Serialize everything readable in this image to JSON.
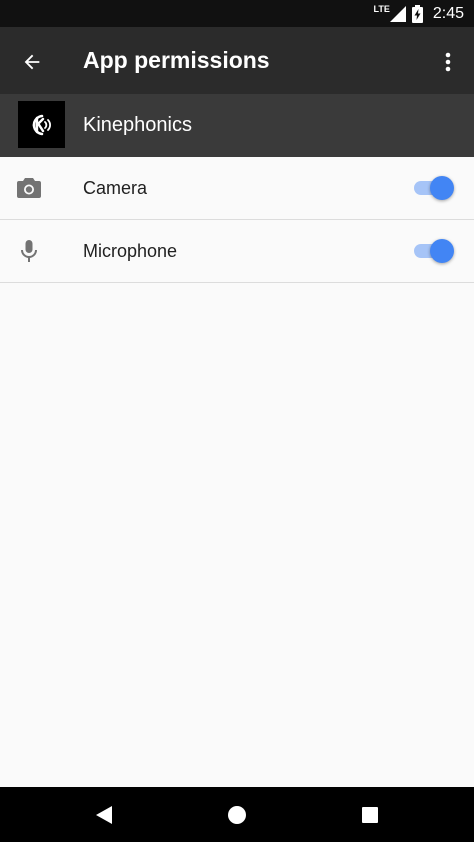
{
  "status_bar": {
    "network": "LTE",
    "time": "2:45"
  },
  "app_bar": {
    "title": "App permissions",
    "back_icon": "arrow-back-icon",
    "overflow_icon": "more-vert-icon"
  },
  "app": {
    "name": "Kinephonics",
    "icon": "kinephonics-logo-icon"
  },
  "permissions": [
    {
      "label": "Camera",
      "icon": "camera-icon",
      "enabled": true
    },
    {
      "label": "Microphone",
      "icon": "microphone-icon",
      "enabled": true
    }
  ],
  "nav_bar": {
    "back": "nav-back-icon",
    "home": "nav-home-icon",
    "recents": "nav-recents-icon"
  },
  "colors": {
    "status_bar": "#111111",
    "app_bar": "#2b2b2b",
    "app_header": "#3a3a3a",
    "toggle_thumb": "#4285f4",
    "toggle_track": "#a6c4f7",
    "background": "#fafafa"
  }
}
